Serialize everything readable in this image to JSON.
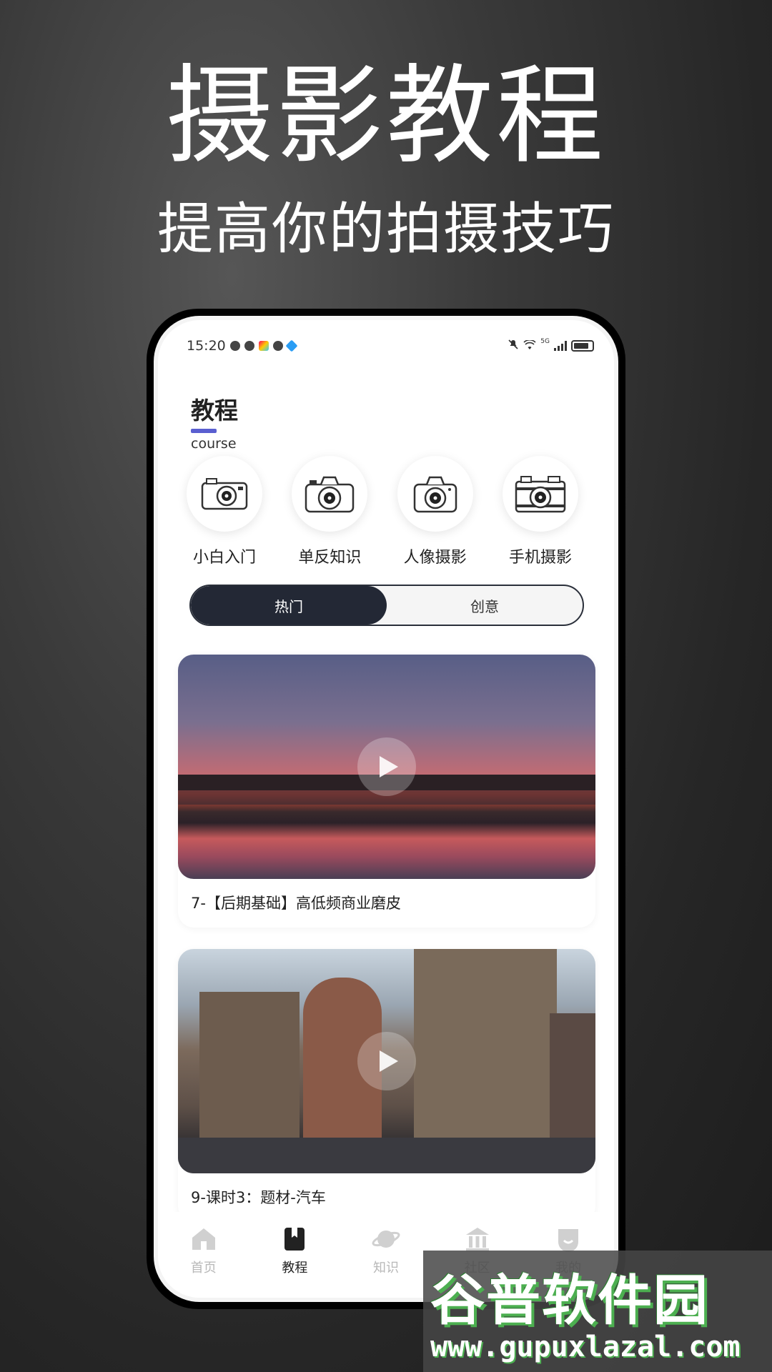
{
  "promo": {
    "title": "摄影教程",
    "subtitle": "提高你的拍摄技巧"
  },
  "status_bar": {
    "time": "15:20",
    "network": "5G"
  },
  "header": {
    "title": "教程",
    "subtitle": "course",
    "accent_color": "#5a5fd0"
  },
  "categories": [
    {
      "label": "小白入门",
      "icon": "compact-camera-icon"
    },
    {
      "label": "单反知识",
      "icon": "dslr-camera-icon"
    },
    {
      "label": "人像摄影",
      "icon": "portrait-camera-icon"
    },
    {
      "label": "手机摄影",
      "icon": "retro-camera-icon"
    }
  ],
  "segments": {
    "hot": "热门",
    "creative": "创意",
    "selected": "热门"
  },
  "videos": [
    {
      "title": "7-【后期基础】高低频商业磨皮",
      "image": "sunset-lake"
    },
    {
      "title": "9-课时3：题材-汽车",
      "image": "city-cathedral"
    }
  ],
  "tabbar": {
    "home": "首页",
    "course": "教程",
    "knowledge": "知识",
    "community": "社区",
    "mine": "我的",
    "selected": "教程"
  },
  "watermark": {
    "brand": "谷普软件园",
    "url": "www.gupuxlazal.com"
  }
}
